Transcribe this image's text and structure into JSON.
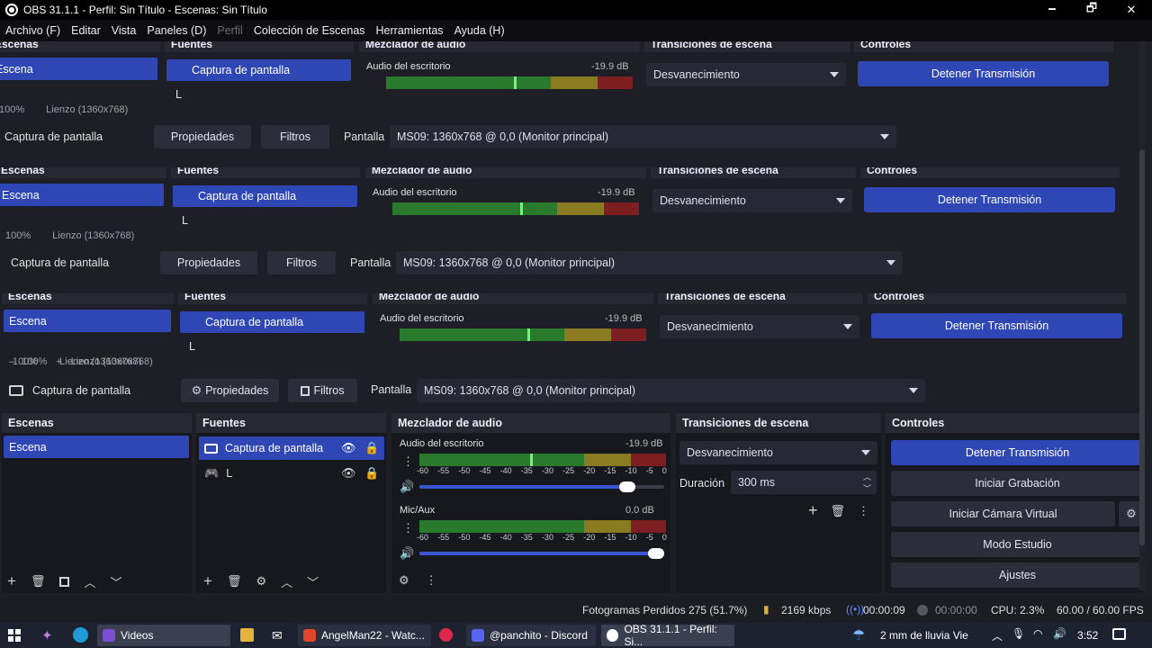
{
  "window": {
    "title": "OBS 31.1.1 - Perfil: Sin Título - Escenas: Sin Título",
    "minimize": "🗕",
    "maximize": "🗗",
    "close": "✕"
  },
  "menu": [
    {
      "label": "Archivo (F)",
      "disabled": false
    },
    {
      "label": "Editar",
      "disabled": false
    },
    {
      "label": "Vista",
      "disabled": false
    },
    {
      "label": "Paneles (D)",
      "disabled": false
    },
    {
      "label": "Perfil",
      "disabled": true
    },
    {
      "label": "Colección de Escenas",
      "disabled": false
    },
    {
      "label": "Herramientas",
      "disabled": false
    },
    {
      "label": "Ayuda (H)",
      "disabled": false
    }
  ],
  "preview": {
    "zoom": "100%",
    "canvas": "Lienzo (1360x768)"
  },
  "source_bar": {
    "source_name": "Captura de pantalla",
    "properties": "Propiedades",
    "filters": "Filtros",
    "display_label": "Pantalla",
    "display_value": "MS09: 1360x768 @ 0,0 (Monitor principal)"
  },
  "scenes": {
    "title": "Escenas",
    "items": [
      "Escena"
    ]
  },
  "sources": {
    "title": "Fuentes",
    "items": [
      "Captura de pantalla",
      "L"
    ]
  },
  "mixer": {
    "title": "Mezclador de audio",
    "ticks": [
      "-60",
      "-55",
      "-50",
      "-45",
      "-40",
      "-35",
      "-30",
      "-25",
      "-20",
      "-15",
      "-10",
      "-5",
      "0"
    ],
    "channels": [
      {
        "name": "Audio del escritorio",
        "db": "-19.9 dB",
        "level": 0.45,
        "volume": 0.88
      },
      {
        "name": "Mic/Aux",
        "db": "0.0 dB",
        "level": 0.0,
        "volume": 1.0
      }
    ]
  },
  "transitions": {
    "title": "Transiciones de escena",
    "type": "Desvanecimiento",
    "duration_label": "Duración",
    "duration_value": "300 ms"
  },
  "controls": {
    "title": "Controles",
    "stop_stream": "Detener Transmisión",
    "start_recording": "Iniciar Grabación",
    "virtual_camera": "Iniciar Cámara Virtual",
    "studio_mode": "Modo Estudio",
    "settings": "Ajustes"
  },
  "status": {
    "dropped": "Fotogramas Perdidos 275 (51.7%)",
    "bitrate": "2169 kbps",
    "stream_time": "00:00:09",
    "rec_time": "00:00:00",
    "cpu": "CPU: 2.3%",
    "fps": "60.00 / 60.00 FPS"
  },
  "taskbar": {
    "items": [
      "Videos",
      "AngelMan22 - Watc...",
      "@panchito - Discord",
      "OBS 31.1.1 - Perfil: Si..."
    ],
    "weather": "2 mm de lluvia Vie",
    "time": "3:52"
  },
  "colors": {
    "accent": "#2f47b5",
    "meter_green": "#2a7a2d",
    "meter_yellow": "#8a7a21",
    "meter_red": "#7d1f22"
  }
}
